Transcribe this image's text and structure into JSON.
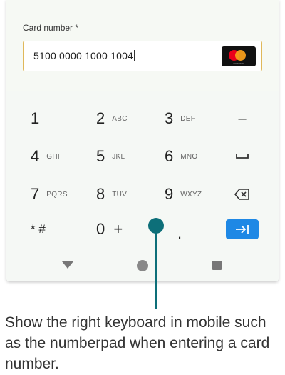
{
  "form": {
    "card_label": "Card number *",
    "card_value": "5100 0000 1000 1004",
    "card_brand": "mastercard"
  },
  "keypad": {
    "keys": [
      {
        "num": "1",
        "letters": ""
      },
      {
        "num": "2",
        "letters": "ABC"
      },
      {
        "num": "3",
        "letters": "DEF"
      },
      {
        "num": "4",
        "letters": "GHI"
      },
      {
        "num": "5",
        "letters": "JKL"
      },
      {
        "num": "6",
        "letters": "MNO"
      },
      {
        "num": "7",
        "letters": "PQRS"
      },
      {
        "num": "8",
        "letters": "TUV"
      },
      {
        "num": "9",
        "letters": "WXYZ"
      },
      {
        "num": "* #",
        "letters": ""
      },
      {
        "num": "0 +",
        "letters": ""
      },
      {
        "num": ".",
        "letters": ""
      }
    ],
    "actions": {
      "minus": "–",
      "space_icon": "space-bar-icon",
      "backspace_icon": "backspace-icon",
      "next_icon": "tab-next-icon"
    },
    "accent_color": "#1e88e5"
  },
  "navbar": {
    "back_icon": "back-triangle-icon",
    "home_icon": "home-circle-icon",
    "recents_icon": "recents-square-icon"
  },
  "annotation": {
    "caption": "Show the right keyboard in mobile such as the numberpad when entering a card number.",
    "pointer_color": "#0d6f79"
  }
}
